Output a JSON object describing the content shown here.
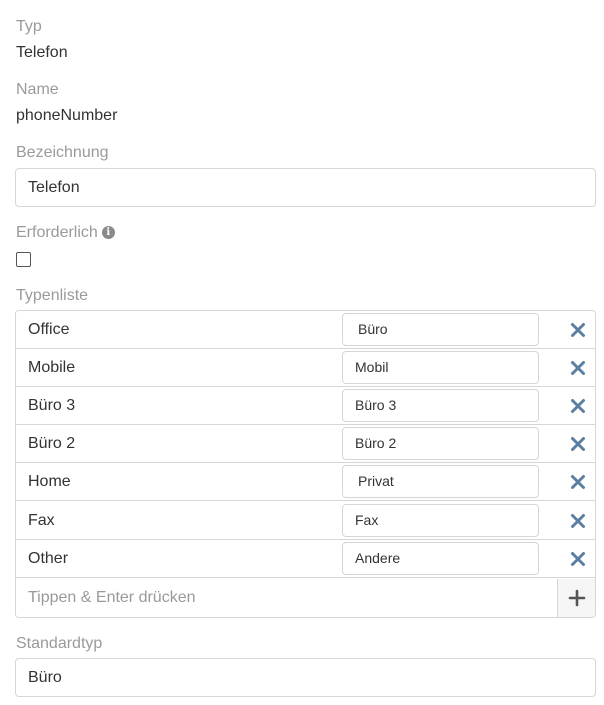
{
  "fields": {
    "typ_label": "Typ",
    "typ_value": "Telefon",
    "name_label": "Name",
    "name_value": "phoneNumber",
    "bezeichnung_label": "Bezeichnung",
    "bezeichnung_value": "Telefon",
    "erforderlich_label": "Erforderlich",
    "erforderlich_checked": false,
    "typenliste_label": "Typenliste",
    "standardtyp_label": "Standardtyp",
    "standardtyp_value": "Büro"
  },
  "type_list": [
    {
      "key": "Office",
      "translation": "Büro"
    },
    {
      "key": "Mobile",
      "translation": "Mobil"
    },
    {
      "key": "Büro 3",
      "translation": "Büro 3"
    },
    {
      "key": "Büro 2",
      "translation": "Büro 2"
    },
    {
      "key": "Home",
      "translation": "Privat"
    },
    {
      "key": "Fax",
      "translation": "Fax"
    },
    {
      "key": "Other",
      "translation": "Andere"
    }
  ],
  "add_input": {
    "placeholder": "Tippen & Enter drücken"
  },
  "colors": {
    "remove_icon": "#5b7fa3",
    "add_icon": "#555555"
  }
}
